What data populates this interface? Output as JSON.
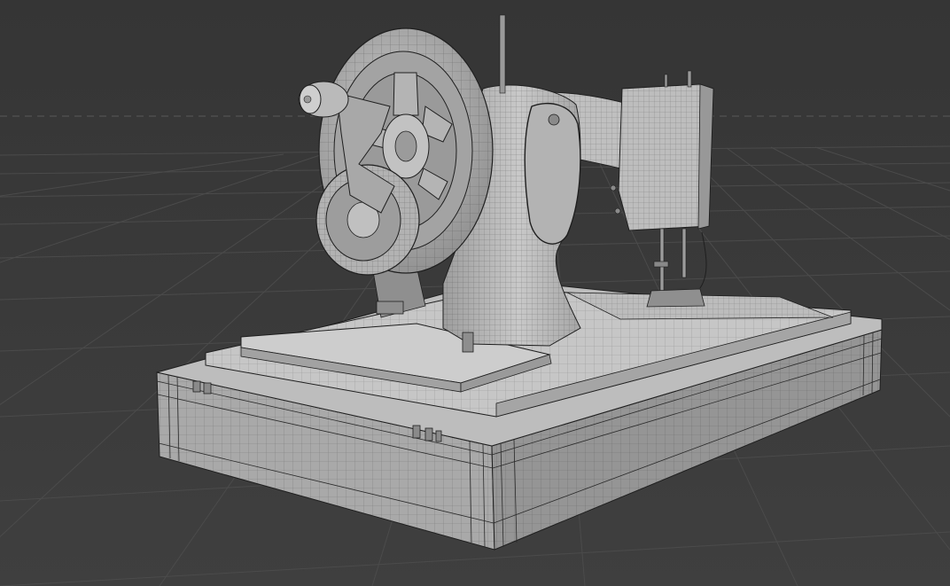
{
  "viewport": {
    "mode": "3d-viewport-wireframe-overlay",
    "subject": "sewing-machine-model",
    "colors": {
      "background_top": "#353535",
      "background_bottom": "#3f3f3f",
      "grid_line": "#4a4a4a",
      "horizon_line": "#555555",
      "model_fill": "#b8b8b8",
      "model_shadow": "#8e8e8e",
      "model_highlight": "#d4d4d4",
      "wire": "#1f1f1f"
    }
  }
}
